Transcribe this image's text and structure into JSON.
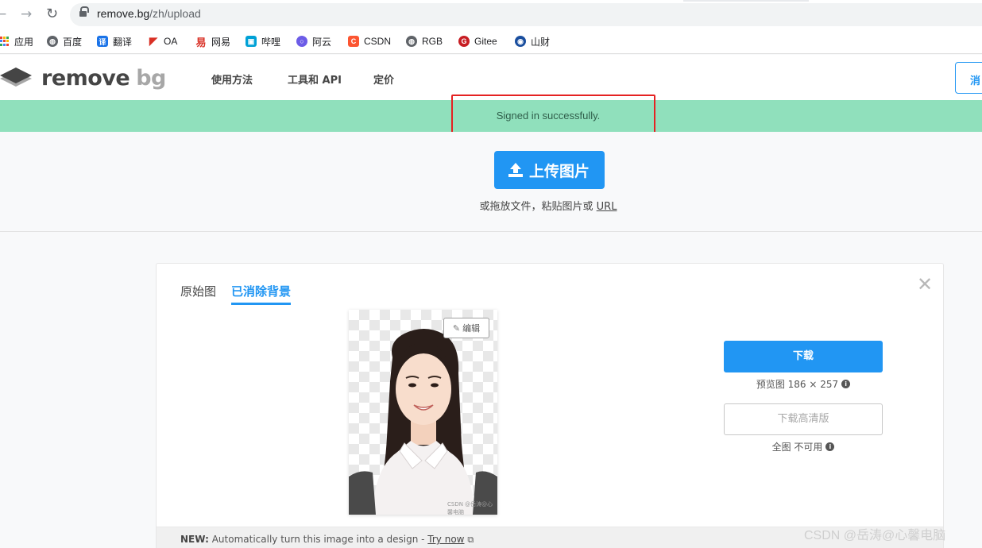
{
  "browser": {
    "url_host": "remove.bg",
    "url_path": "/zh/upload",
    "bookmarks": [
      {
        "label": "应用",
        "icon": "apps-grid-icon",
        "color": "#4285f4"
      },
      {
        "label": "百度",
        "icon": "globe-icon",
        "color": "#5f6368"
      },
      {
        "label": "翻译",
        "icon": "translate-icon",
        "color": "#1a73e8"
      },
      {
        "label": "OA",
        "icon": "oa-flag-icon",
        "color": "#d93025"
      },
      {
        "label": "网易",
        "icon": "netease-icon",
        "color": "#d93025"
      },
      {
        "label": "哔哩",
        "icon": "bilibili-icon",
        "color": "#00a1d6"
      },
      {
        "label": "阿云",
        "icon": "aliyun-icon",
        "color": "#6c5ce7"
      },
      {
        "label": "CSDN",
        "icon": "csdn-icon",
        "color": "#fc5531"
      },
      {
        "label": "RGB",
        "icon": "globe-icon",
        "color": "#5f6368"
      },
      {
        "label": "Gitee",
        "icon": "gitee-icon",
        "color": "#c71d23"
      },
      {
        "label": "山财",
        "icon": "school-icon",
        "color": "#1a4e9e"
      }
    ]
  },
  "header": {
    "logo_word1": "remove",
    "logo_word2": "bg",
    "nav": [
      "使用方法",
      "工具和 API",
      "定价"
    ],
    "right_button_label": "消"
  },
  "flash": {
    "message": "Signed in successfully."
  },
  "upload": {
    "button_label": "上传图片",
    "hint_prefix": "或拖放文件，粘贴图片或 ",
    "hint_link": "URL"
  },
  "result": {
    "tabs": [
      {
        "label": "原始图",
        "active": false
      },
      {
        "label": "已消除背景",
        "active": true
      }
    ],
    "close_label": "✕",
    "edit_label": "编辑",
    "preview_watermark": "CSDN @岳涛@心馨电脑",
    "download_label": "下载",
    "preview_info": "预览图 186 × 257",
    "hd_label": "下载高清版",
    "hd_info": "全图 不可用",
    "footer_new": "NEW:",
    "footer_text": " Automatically turn this image into a design - ",
    "footer_link": "Try now"
  },
  "watermark": "CSDN @岳涛@心馨电脑",
  "colors": {
    "accent": "#2196f3",
    "flash_bg": "#90e0bc",
    "highlight": "#e52222"
  }
}
